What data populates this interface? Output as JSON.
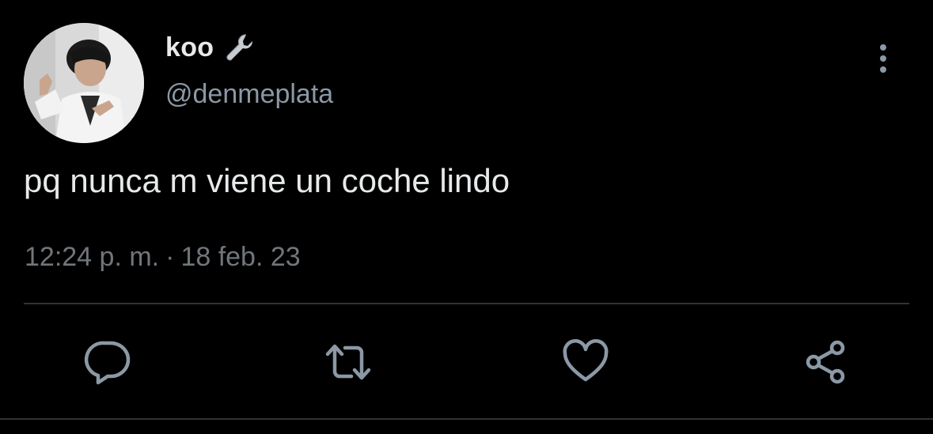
{
  "user": {
    "display_name": "koo",
    "handle": "@denmeplata",
    "badge_icon": "wrench-icon",
    "avatar": "profile-photo"
  },
  "tweet": {
    "text": "pq nunca m viene un coche lindo",
    "time": "12:24 p. m.",
    "separator": "·",
    "date": "18 feb. 23"
  },
  "actions": [
    {
      "name": "reply",
      "icon": "comment-icon"
    },
    {
      "name": "retweet",
      "icon": "retweet-icon"
    },
    {
      "name": "like",
      "icon": "heart-icon"
    },
    {
      "name": "share",
      "icon": "share-icon"
    }
  ],
  "colors": {
    "background": "#000000",
    "primary_text": "#e7e9ea",
    "secondary_text": "#71767b",
    "icon": "#8b98a5",
    "divider": "#2f3336"
  }
}
